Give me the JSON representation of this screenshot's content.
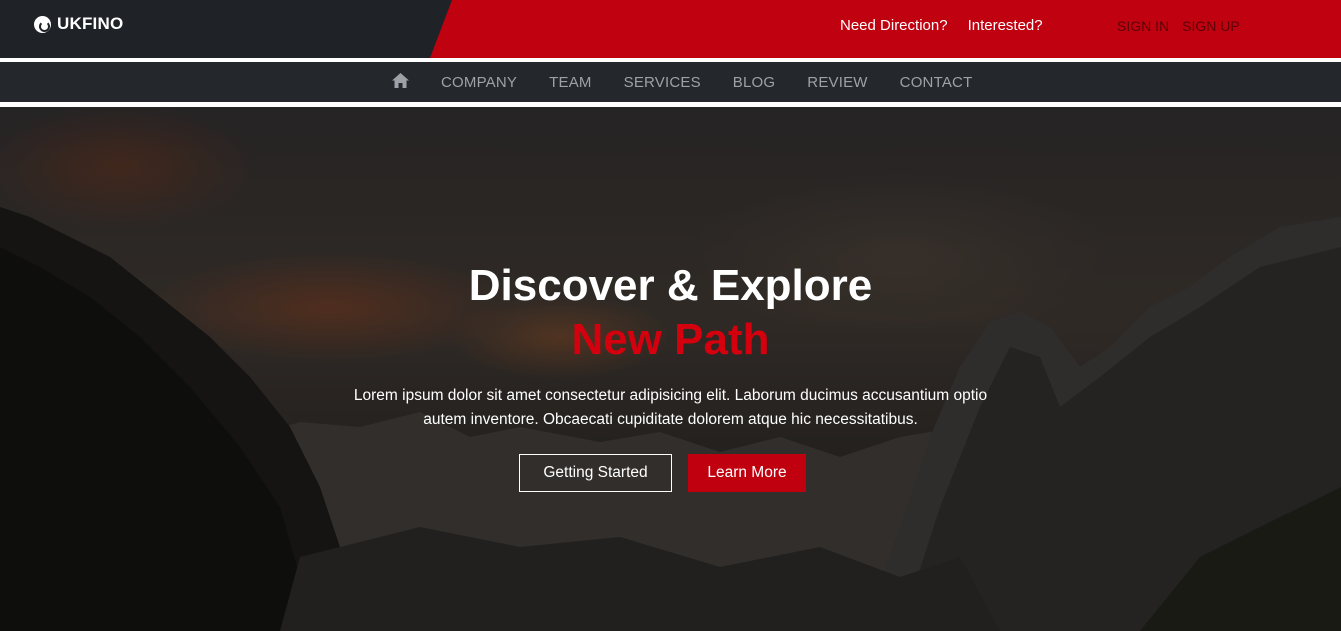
{
  "brand": {
    "name": "UKFINO"
  },
  "top_links": [
    "Need Direction?",
    "Interested?"
  ],
  "auth": {
    "sign_in": "SIGN IN",
    "sign_up": "SIGN UP"
  },
  "nav": {
    "home_icon": "home-icon",
    "items": [
      "COMPANY",
      "TEAM",
      "SERVICES",
      "BLOG",
      "REVIEW",
      "CONTACT"
    ]
  },
  "hero": {
    "title": "Discover & Explore",
    "subtitle": "New Path",
    "text": "Lorem ipsum dolor sit amet consectetur adipisicing elit. Laborum ducimus accusantium optio autem inventore. Obcaecati cupiditate dolorem atque hic necessitatibus.",
    "btn_primary": "Getting Started",
    "btn_secondary": "Learn More"
  },
  "colors": {
    "accent": "#c0010f",
    "dark": "#1f2226",
    "nav": "#24272c"
  }
}
